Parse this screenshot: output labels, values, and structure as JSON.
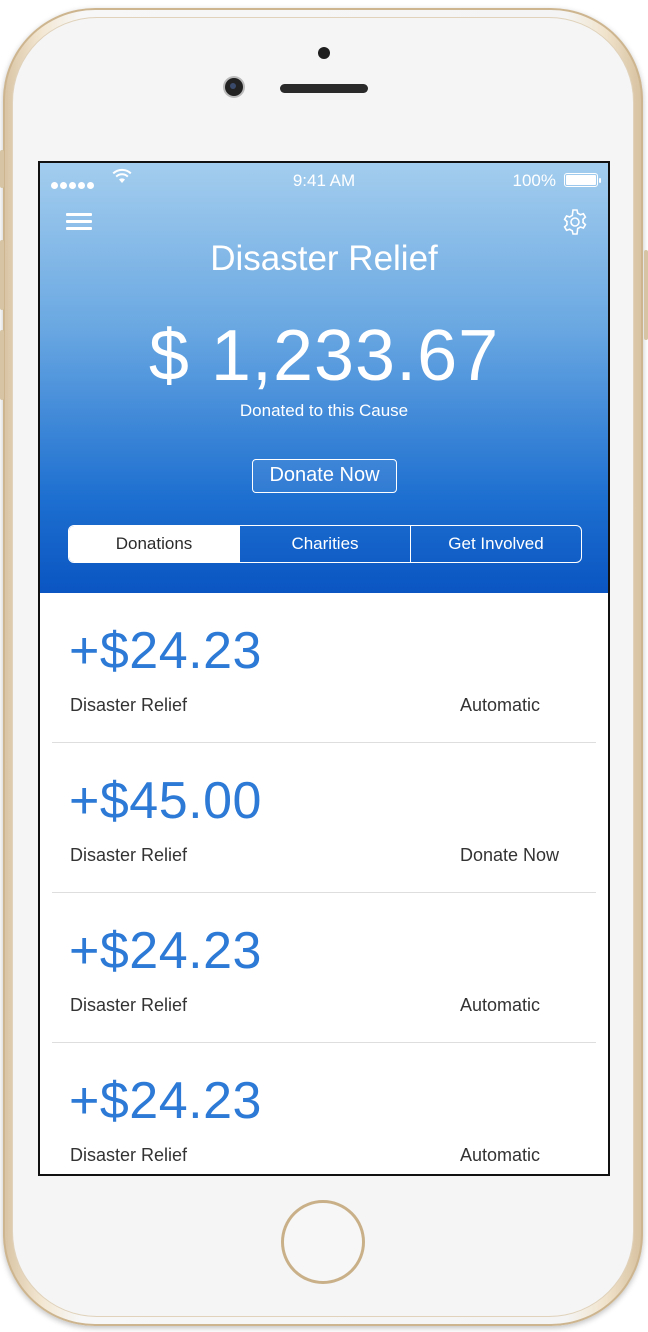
{
  "status_bar": {
    "time": "9:41 AM",
    "battery": "100%"
  },
  "header": {
    "title": "Disaster Relief",
    "amount": "$ 1,233.67",
    "amount_caption": "Donated to this Cause",
    "donate_button": "Donate Now"
  },
  "tabs": [
    {
      "label": "Donations",
      "active": true
    },
    {
      "label": "Charities",
      "active": false
    },
    {
      "label": "Get Involved",
      "active": false
    }
  ],
  "donations": [
    {
      "amount": "+$24.23",
      "cause": "Disaster Relief",
      "type": "Automatic"
    },
    {
      "amount": "+$45.00",
      "cause": "Disaster Relief",
      "type": "Donate Now"
    },
    {
      "amount": "+$24.23",
      "cause": "Disaster Relief",
      "type": "Automatic"
    },
    {
      "amount": "+$24.23",
      "cause": "Disaster Relief",
      "type": "Automatic"
    }
  ],
  "colors": {
    "accent": "#2c79d6",
    "hero_top": "#a3cdee",
    "hero_bottom": "#0a55c2"
  },
  "icons": [
    "menu-icon",
    "gear-icon",
    "wifi-icon",
    "battery-icon"
  ]
}
